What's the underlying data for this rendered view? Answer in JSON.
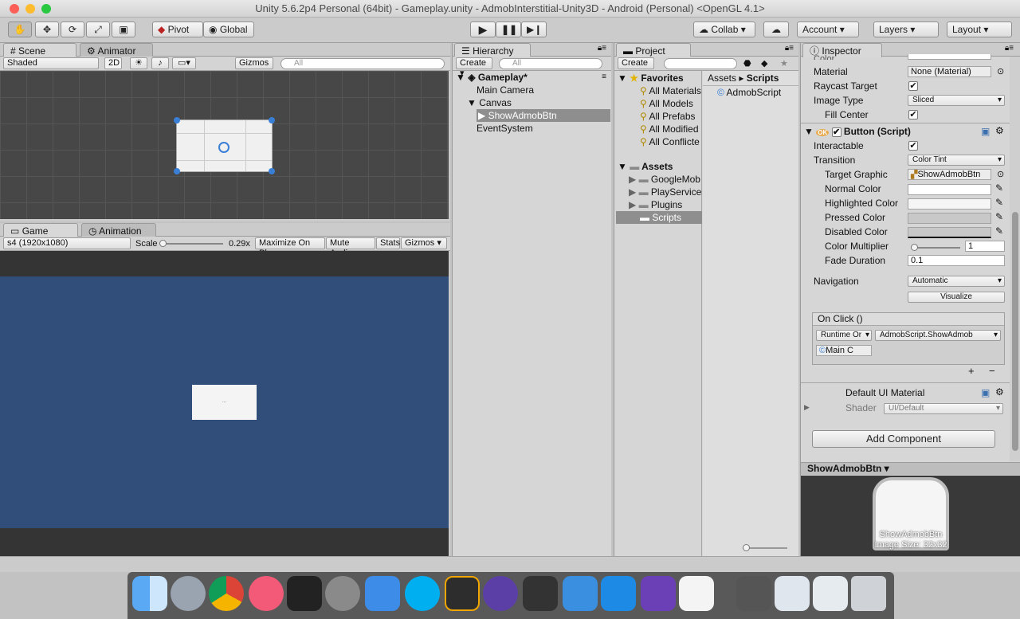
{
  "window": {
    "title": "Unity 5.6.2p4 Personal (64bit) - Gameplay.unity - AdmobInterstitial-Unity3D - Android (Personal) <OpenGL 4.1>"
  },
  "toolbar": {
    "pivot": "Pivot",
    "global": "Global",
    "collab": "Collab",
    "account": "Account",
    "layers": "Layers",
    "layout": "Layout"
  },
  "scene": {
    "tab_scene": "Scene",
    "tab_animator": "Animator",
    "shading": "Shaded",
    "mode2d": "2D",
    "gizmos": "Gizmos",
    "search_placeholder": "All"
  },
  "game": {
    "tab_game": "Game",
    "tab_animation": "Animation",
    "resolution": "s4 (1920x1080)",
    "scale_label": "Scale",
    "scale_value": "0.29x",
    "maximize": "Maximize On Play",
    "mute": "Mute Audio",
    "stats": "Stats",
    "gizmos": "Gizmos"
  },
  "hierarchy": {
    "tab": "Hierarchy",
    "create": "Create",
    "search_placeholder": "All",
    "scene_name": "Gameplay*",
    "items": [
      "Main Camera",
      "Canvas",
      "ShowAdmobBtn",
      "EventSystem"
    ]
  },
  "project": {
    "tab": "Project",
    "create": "Create",
    "favorites_label": "Favorites",
    "favorites": [
      "All Materials",
      "All Models",
      "All Prefabs",
      "All Modified",
      "All Conflicte"
    ],
    "assets_label": "Assets",
    "assets": [
      "GoogleMob",
      "PlayServices",
      "Plugins",
      "Scripts"
    ],
    "breadcrumb_root": "Assets",
    "breadcrumb_current": "Scripts",
    "files": [
      "AdmobScript"
    ]
  },
  "inspector": {
    "tab": "Inspector",
    "color_label": "Color",
    "material_label": "Material",
    "material_value": "None (Material)",
    "raycast_label": "Raycast Target",
    "image_type_label": "Image Type",
    "image_type_value": "Sliced",
    "fill_center_label": "Fill Center",
    "button_component": "Button (Script)",
    "interactable_label": "Interactable",
    "transition_label": "Transition",
    "transition_value": "Color Tint",
    "target_graphic_label": "Target Graphic",
    "target_graphic_value": "ShowAdmobBtn",
    "normal_color": "Normal Color",
    "highlighted_color": "Highlighted Color",
    "pressed_color": "Pressed Color",
    "disabled_color": "Disabled Color",
    "color_multiplier": "Color Multiplier",
    "color_multiplier_value": "1",
    "fade_duration": "Fade Duration",
    "fade_duration_value": "0.1",
    "navigation_label": "Navigation",
    "navigation_value": "Automatic",
    "visualize": "Visualize",
    "onclick_label": "On Click ()",
    "runtime_value": "Runtime Or",
    "function_value": "AdmobScript.ShowAdmob",
    "object_value": "Main C",
    "material_name": "Default UI Material",
    "shader_label": "Shader",
    "shader_value": "UI/Default",
    "add_component": "Add Component"
  },
  "preview": {
    "title": "ShowAdmobBtn",
    "name": "ShowAdmobBtn",
    "size": "Image Size: 32x32"
  },
  "colors": {
    "scene_bg": "#474747",
    "game_bg": "#314d79",
    "selection": "#8e8e8e"
  }
}
